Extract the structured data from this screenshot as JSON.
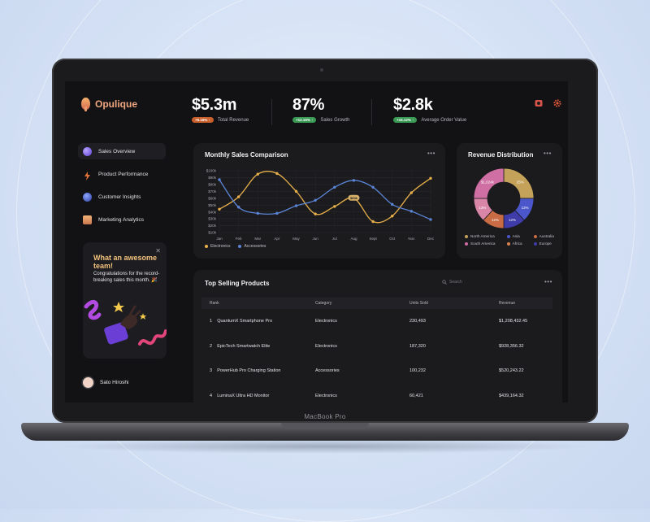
{
  "device_label": "MacBook Pro",
  "app": {
    "name": "Opulique"
  },
  "kpis": [
    {
      "value": "$5.3m",
      "badge": "+5.16% ↑",
      "badge_color": "#c8602d",
      "label": "Total Revenue"
    },
    {
      "value": "87%",
      "badge": "+12.15% ↑",
      "badge_color": "#3a9a55",
      "label": "Sales Growth"
    },
    {
      "value": "$2.8k",
      "badge": "+15.12% ↑",
      "badge_color": "#3a9a55",
      "label": "Average Order Value"
    }
  ],
  "top_icons": {
    "left": "notification-icon",
    "right": "settings-icon"
  },
  "nav": [
    {
      "label": "Sales Overview",
      "icon": "globe-icon",
      "active": true
    },
    {
      "label": "Product Performance",
      "icon": "lightning-icon",
      "active": false
    },
    {
      "label": "Customer Insights",
      "icon": "planet-icon",
      "active": false
    },
    {
      "label": "Marketing Analytics",
      "icon": "folder-icon",
      "active": false
    }
  ],
  "promo": {
    "title": "What an awesome team!",
    "text": "Congratulations for the record-breaking sales this month. 🎉",
    "close": "✕"
  },
  "user": {
    "name": "Sato Hiroshi"
  },
  "monthly_chart": {
    "title": "Monthly Sales Comparison",
    "more": "•••",
    "tooltip": "$60k",
    "legend": [
      "Electronics",
      "Accessories"
    ]
  },
  "revenue_chart": {
    "title": "Revenue Distribution",
    "more": "•••",
    "legend": [
      "North America",
      "Asia",
      "Australia",
      "South America",
      "Africa",
      "Europe"
    ]
  },
  "products": {
    "title": "Top Selling Products",
    "search_placeholder": "Search",
    "more": "•••",
    "columns": [
      "Rank",
      "Category",
      "Units Sold",
      "Revenue"
    ],
    "rows": [
      {
        "rank": "1",
        "name": "QuantumX Smartphone Pro",
        "category": "Electronics",
        "units": "230,493",
        "revenue": "$1,208,432.45"
      },
      {
        "rank": "2",
        "name": "EpicTech Smartwatch Elite",
        "category": "Electronics",
        "units": "187,320",
        "revenue": "$928,356.32"
      },
      {
        "rank": "3",
        "name": "PowerHub Pro Charging Station",
        "category": "Accessories",
        "units": "100,232",
        "revenue": "$520,243.22"
      },
      {
        "rank": "4",
        "name": "LuminaX Ultra HD Monitor",
        "category": "Electronics",
        "units": "60,421",
        "revenue": "$439,164.32"
      }
    ]
  },
  "colors": {
    "electronics": "#e8b04a",
    "accessories": "#5b84d6",
    "accent": "#f0a680"
  },
  "chart_data": [
    {
      "type": "line",
      "title": "Monthly Sales Comparison",
      "categories": [
        "Jan",
        "Feb",
        "Mar",
        "Apr",
        "May",
        "Jun",
        "Jul",
        "Aug",
        "Sept",
        "Oct",
        "Nov",
        "Dec"
      ],
      "y_ticks": [
        "$100k",
        "$90k",
        "$80k",
        "$70k",
        "$60k",
        "$50k",
        "$40k",
        "$30k",
        "$20k",
        "$10k"
      ],
      "ylim": [
        10,
        100
      ],
      "series": [
        {
          "name": "Electronics",
          "color": "#e8b04a",
          "values": [
            44,
            62,
            95,
            96,
            70,
            37,
            48,
            60,
            26,
            34,
            68,
            89
          ]
        },
        {
          "name": "Accessories",
          "color": "#5b84d6",
          "values": [
            87,
            47,
            38,
            38,
            49,
            57,
            76,
            86,
            76,
            51,
            41,
            29
          ]
        }
      ],
      "grid": true,
      "legend_position": "bottom-left"
    },
    {
      "type": "pie",
      "title": "Revenue Distribution",
      "slices": [
        {
          "label": "25%",
          "region": "North America",
          "value": 25,
          "color": "#c4a25a"
        },
        {
          "label": "13%",
          "region": "Asia",
          "value": 13,
          "color": "#4a56c9"
        },
        {
          "label": "12%",
          "region": "Europe",
          "value": 12,
          "color": "#3f3ba8"
        },
        {
          "label": "12%",
          "region": "Australia",
          "value": 12,
          "color": "#c96c45"
        },
        {
          "label": "13%",
          "region": "Africa",
          "value": 13,
          "color": "#d985a8"
        },
        {
          "label": "$1,024k",
          "region": "South America",
          "value": 25,
          "color": "#cf6fa3"
        }
      ]
    }
  ]
}
